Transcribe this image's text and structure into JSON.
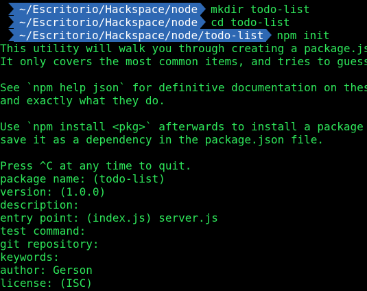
{
  "terminal": {
    "prompts": [
      {
        "path": "~/Escritorio/Hackspace/node",
        "command": "mkdir todo-list"
      },
      {
        "path": "~/Escritorio/Hackspace/node",
        "command": "cd todo-list"
      },
      {
        "path": "~/Escritorio/Hackspace/node/todo-list",
        "command": "npm init"
      }
    ],
    "output": {
      "intro_1": "This utility will walk you through creating a package.json file.",
      "intro_2": "It only covers the most common items, and tries to guess sensible defaults.",
      "help_1": "See `npm help json` for definitive documentation on these fields",
      "help_2": "and exactly what they do.",
      "install_1": "Use `npm install <pkg>` afterwards to install a package and",
      "install_2": "save it as a dependency in the package.json file.",
      "quit": "Press ^C at any time to quit.",
      "package_name": "package name: (todo-list)",
      "version": "version: (1.0.0)",
      "description": "description:",
      "entry_point": "entry point: (index.js) server.js",
      "test_command": "test command:",
      "git_repository": "git repository:",
      "keywords": "keywords:",
      "author": "author: Gerson",
      "license": "license: (ISC)"
    },
    "colors": {
      "background": "#000000",
      "text": "#2ee65a",
      "prompt_segment": "#2e68b3",
      "prompt_text": "#ffffff"
    }
  }
}
